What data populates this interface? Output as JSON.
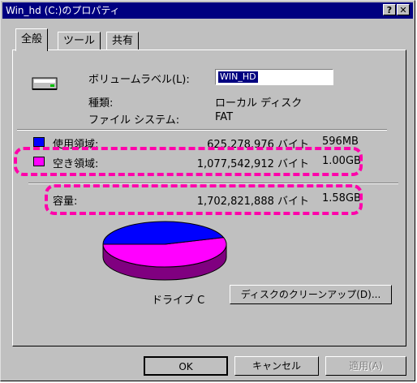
{
  "window": {
    "title": "Win_hd (C:)のプロパティ",
    "help_btn": "?",
    "close_btn": "✕"
  },
  "tabs": [
    "全般",
    "ツール",
    "共有"
  ],
  "drive": {
    "volume_label_caption": "ボリュームラベル(L):",
    "volume_label_value": "WIN_HD",
    "type_caption": "種類:",
    "type_value": "ローカル ディスク",
    "fs_caption": "ファイル システム:",
    "fs_value": "FAT"
  },
  "usage": {
    "used_label": "使用領域:",
    "used_bytes": "625,278,976 バイト",
    "used_short": "596MB",
    "free_label": "空き領域:",
    "free_bytes": "1,077,542,912 バイト",
    "free_short": "1.00GB",
    "capacity_label": "容量:",
    "capacity_bytes": "1,702,821,888 バイト",
    "capacity_short": "1.58GB",
    "used_fraction": 0.367
  },
  "colors": {
    "used": "#0000ff",
    "free": "#ff00ff",
    "highlight": "#ff00aa",
    "titlebar": "#000080"
  },
  "pie_caption": "ドライブ C",
  "cleanup_button": "ディスクのクリーンアップ(D)...",
  "footer": {
    "ok": "OK",
    "cancel": "キャンセル",
    "apply": "適用(A)"
  }
}
